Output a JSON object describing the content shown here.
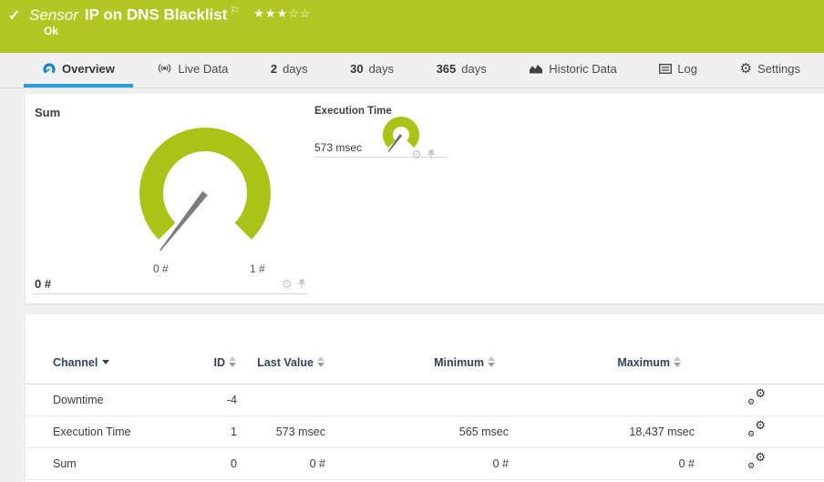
{
  "header": {
    "check_icon": "✓",
    "type_label": "Sensor",
    "title": "IP on DNS Blacklist",
    "flag_icon": "⚐",
    "stars_filled": "★★★",
    "stars_empty": "☆☆",
    "status": "Ok"
  },
  "tabs": {
    "overview": "Overview",
    "live_data": "Live Data",
    "d2_num": "2",
    "d2_unit": "days",
    "d30_num": "30",
    "d30_unit": "days",
    "d365_num": "365",
    "d365_unit": "days",
    "historic": "Historic Data",
    "log": "Log",
    "settings": "Settings"
  },
  "gauges": {
    "sum": {
      "title": "Sum",
      "min_label": "0 #",
      "max_label": "1 #",
      "value_label": "0 #"
    },
    "execution_time": {
      "title": "Execution Time",
      "value_label": "573 msec"
    }
  },
  "chart_data": [
    {
      "type": "gauge",
      "title": "Sum",
      "min": 0,
      "max": 1,
      "value": 0,
      "unit": "#",
      "min_label": "0 #",
      "max_label": "1 #",
      "color": "#a9c417",
      "sweep_deg": 270,
      "gap_position": "bottom"
    },
    {
      "type": "gauge",
      "title": "Execution Time",
      "value": 573,
      "unit": "msec",
      "color": "#a9c417",
      "sweep_deg": 270,
      "gap_position": "bottom"
    },
    {
      "type": "table",
      "columns": [
        "Channel",
        "ID",
        "Last Value",
        "Minimum",
        "Maximum"
      ],
      "rows": [
        [
          "Downtime",
          "-4",
          "",
          "",
          ""
        ],
        [
          "Execution Time",
          "1",
          "573 msec",
          "565 msec",
          "18,437 msec"
        ],
        [
          "Sum",
          "0",
          "0 #",
          "0 #",
          "0 #"
        ]
      ]
    }
  ],
  "table": {
    "headers": {
      "channel": "Channel",
      "id": "ID",
      "last_value": "Last Value",
      "minimum": "Minimum",
      "maximum": "Maximum"
    },
    "rows": [
      {
        "channel": "Downtime",
        "id": "-4",
        "last_value": "",
        "minimum": "",
        "maximum": ""
      },
      {
        "channel": "Execution Time",
        "id": "1",
        "last_value": "573 msec",
        "minimum": "565 msec",
        "maximum": "18,437 msec"
      },
      {
        "channel": "Sum",
        "id": "0",
        "last_value": "0 #",
        "minimum": "0 #",
        "maximum": "0 #"
      }
    ]
  },
  "colors": {
    "brand_green": "#b2c723",
    "gauge_green": "#a9c417",
    "accent_blue": "#2aa0d8",
    "table_header_text": "#33425b"
  }
}
